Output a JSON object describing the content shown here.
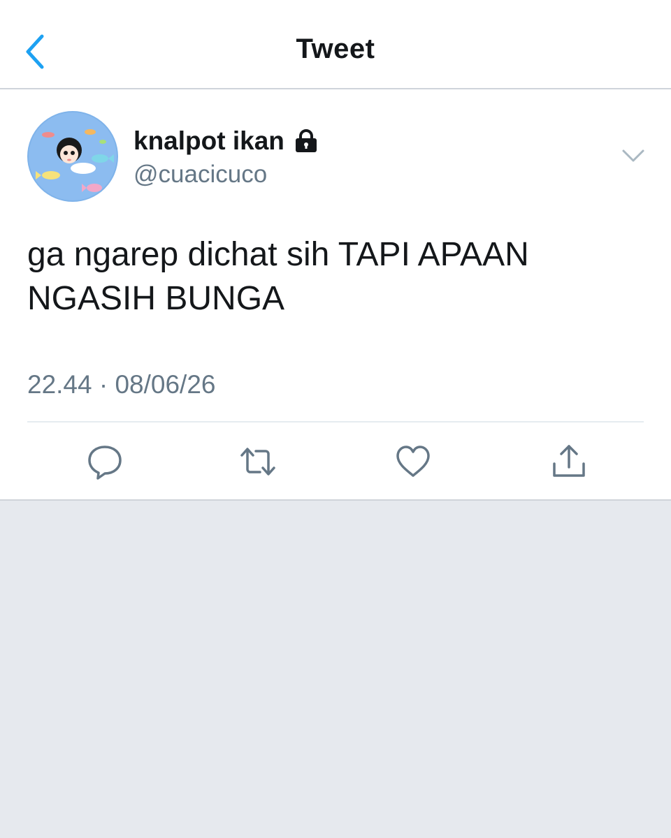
{
  "header": {
    "title": "Tweet",
    "back_icon": "chevron-left-icon"
  },
  "tweet": {
    "author": {
      "display_name": "knalpot ikan",
      "handle": "@cuacicuco",
      "protected_icon": "lock-icon",
      "avatar": "avatar-image"
    },
    "text_lines": [
      "ga ngarep dichat sih TAPI APAAN",
      "NGASIH BUNGA"
    ],
    "timestamp": "22.44 · 08/06/26",
    "actions": [
      {
        "name": "reply",
        "icon": "reply-icon"
      },
      {
        "name": "retweet",
        "icon": "retweet-icon"
      },
      {
        "name": "like",
        "icon": "heart-icon"
      },
      {
        "name": "share",
        "icon": "share-icon"
      }
    ],
    "more_icon": "chevron-down-icon"
  },
  "colors": {
    "accent": "#1da1f2",
    "text_primary": "#14171a",
    "text_secondary": "#657786",
    "background": "#e6e9ee",
    "card": "#ffffff"
  }
}
